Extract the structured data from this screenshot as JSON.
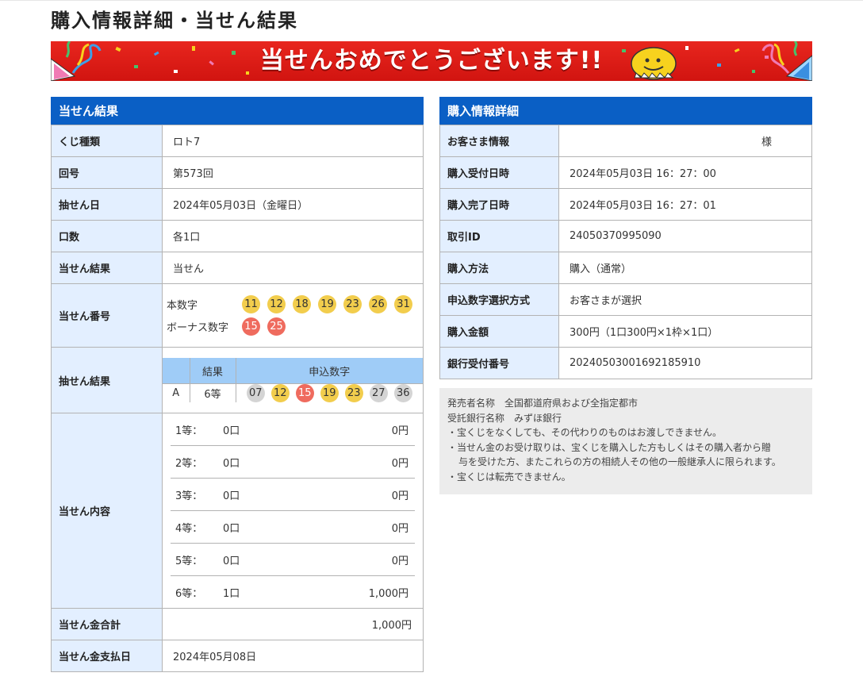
{
  "page": {
    "title": "購入情報詳細・当せん結果",
    "banner_text": "当せんおめでとうございます!!"
  },
  "result": {
    "heading": "当せん結果",
    "rows": {
      "kind": {
        "label": "くじ種類",
        "value": "ロト7"
      },
      "round": {
        "label": "回号",
        "value": "第573回"
      },
      "draw_date": {
        "label": "抽せん日",
        "value": "2024年05月03日（金曜日）"
      },
      "units": {
        "label": "口数",
        "value": "各1口"
      },
      "outcome": {
        "label": "当せん結果",
        "value": "当せん"
      }
    },
    "winning": {
      "label": "当せん番号",
      "main_label": "本数字",
      "main": [
        "11",
        "12",
        "18",
        "19",
        "23",
        "26",
        "31"
      ],
      "bonus_label": "ボーナス数字",
      "bonus": [
        "15",
        "25"
      ]
    },
    "draw": {
      "label": "抽せん結果",
      "col_result": "結果",
      "col_numbers": "申込数字",
      "row_id": "A",
      "row_result": "6等",
      "numbers": [
        {
          "n": "07",
          "state": "miss"
        },
        {
          "n": "12",
          "state": "main"
        },
        {
          "n": "15",
          "state": "bonus"
        },
        {
          "n": "19",
          "state": "main"
        },
        {
          "n": "23",
          "state": "main"
        },
        {
          "n": "27",
          "state": "miss"
        },
        {
          "n": "36",
          "state": "miss"
        }
      ]
    },
    "prizes": {
      "label": "当せん内容",
      "items": [
        {
          "rank": "1等：",
          "count": "0口",
          "amount": "0円"
        },
        {
          "rank": "2等：",
          "count": "0口",
          "amount": "0円"
        },
        {
          "rank": "3等：",
          "count": "0口",
          "amount": "0円"
        },
        {
          "rank": "4等：",
          "count": "0口",
          "amount": "0円"
        },
        {
          "rank": "5等：",
          "count": "0口",
          "amount": "0円"
        },
        {
          "rank": "6等：",
          "count": "1口",
          "amount": "1,000円"
        }
      ]
    },
    "total": {
      "label": "当せん金合計",
      "value": "1,000円"
    },
    "pay_date": {
      "label": "当せん金支払日",
      "value": "2024年05月08日"
    }
  },
  "purchase": {
    "heading": "購入情報詳細",
    "rows": {
      "customer": {
        "label": "お客さま情報",
        "value": "様"
      },
      "accepted": {
        "label": "購入受付日時",
        "value": "2024年05月03日 16：27：00"
      },
      "completed": {
        "label": "購入完了日時",
        "value": "2024年05月03日 16：27：01"
      },
      "txn_id": {
        "label": "取引ID",
        "value": "24050370995090"
      },
      "method": {
        "label": "購入方法",
        "value": "購入（通常）"
      },
      "selection": {
        "label": "申込数字選択方式",
        "value": "お客さまが選択"
      },
      "amount": {
        "label": "購入金額",
        "value": "300円（1口300円×1枠×1口）"
      },
      "bank_no": {
        "label": "銀行受付番号",
        "value": "20240503001692185910"
      }
    }
  },
  "notes": {
    "seller": "発売者名称　全国都道府県および全指定都市",
    "bank": "受託銀行名称　みずほ銀行",
    "line1": "・宝くじをなくしても、その代わりのものはお渡しできません。",
    "line2a": "・当せん金のお受け取りは、宝くじを購入した方もしくはその購入者から贈",
    "line2b": "与を受けた方、またこれらの方の相続人その他の一般継承人に限られます。",
    "line3": "・宝くじは転売できません。"
  },
  "colors": {
    "header_blue": "#0a5fc5",
    "label_bg": "#e3efff",
    "draw_head": "#9fccf7",
    "ball_main": "#f2cd4d",
    "ball_bonus": "#ef6b5e",
    "ball_miss": "#d4d4d4",
    "banner_red": "#e8261e"
  }
}
